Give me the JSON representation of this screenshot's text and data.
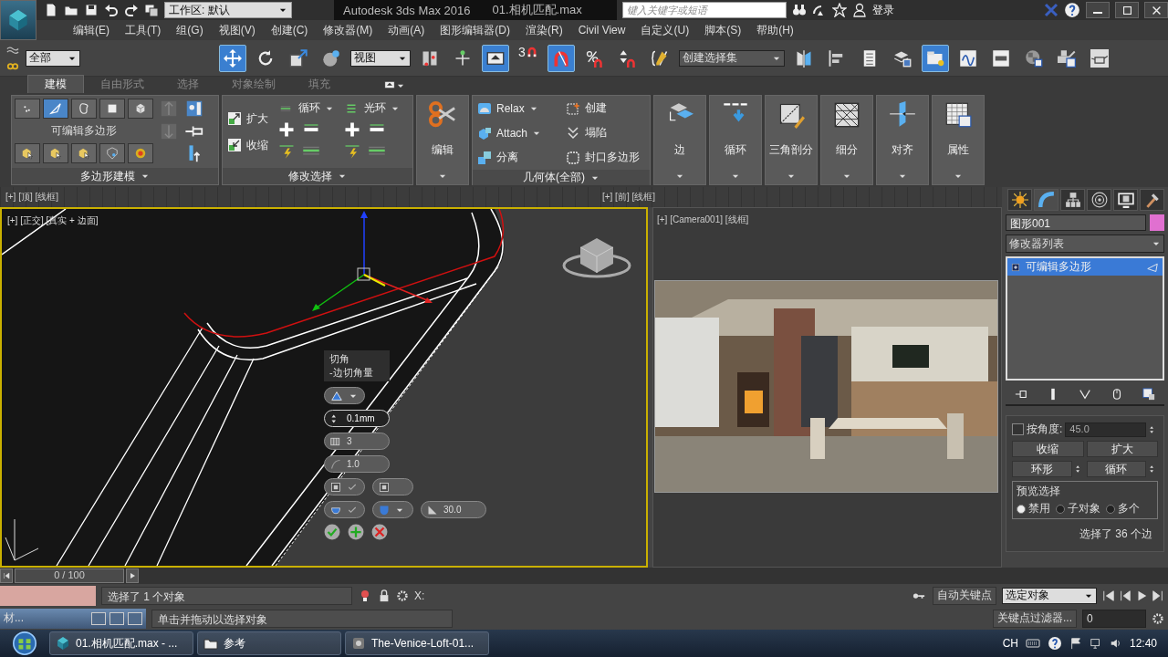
{
  "title_bar": {
    "workspace": "工作区: 默认",
    "app_title": "Autodesk 3ds Max 2016",
    "file_name": "01.相机匹配.max",
    "search": {
      "placeholder": "键入关键字或短语"
    },
    "sign_in": "登录"
  },
  "menu_bar": [
    "编辑(E)",
    "工具(T)",
    "组(G)",
    "视图(V)",
    "创建(C)",
    "修改器(M)",
    "动画(A)",
    "图形编辑器(D)",
    "渲染(R)",
    "Civil View",
    "自定义(U)",
    "脚本(S)",
    "帮助(H)"
  ],
  "main_toolbar": {
    "selection_filter": "全部",
    "reference_coordinate": "视图",
    "snap_count": "3",
    "named_selection": "创建选择集"
  },
  "ribbon": {
    "tabs": [
      {
        "label": "建模",
        "selected": true
      },
      {
        "label": "自由形式",
        "selected": false
      },
      {
        "label": "选择",
        "selected": false
      },
      {
        "label": "对象绘制",
        "selected": false
      },
      {
        "label": "填充",
        "selected": false
      }
    ],
    "polygon_modeling": {
      "title": "多边形建模",
      "object_type": "可编辑多边形",
      "subobject_levels": [
        {
          "selected": false
        },
        {
          "selected": true
        },
        {
          "selected": false
        },
        {
          "selected": false
        },
        {
          "selected": false
        }
      ]
    },
    "modify_selection": {
      "title": "修改选择",
      "grow": "扩大",
      "shrink": "收缩",
      "loop": "循环",
      "ring": "光环"
    },
    "edit": {
      "label": "编辑"
    },
    "geometry": {
      "title": "几何体(全部)",
      "items": [
        {
          "label": "Relax",
          "dropdown": true
        },
        {
          "label": "Attach",
          "dropdown": true
        },
        {
          "label": "分离",
          "dropdown": false
        },
        {
          "label": "创建",
          "dropdown": false
        },
        {
          "label": "塌陷",
          "dropdown": false
        },
        {
          "label": "封口多边形",
          "dropdown": false
        }
      ]
    },
    "big_buttons": [
      "边",
      "循环",
      "三角剖分",
      "细分",
      "对齐",
      "属性"
    ]
  },
  "viewports": {
    "top_left_label": "[+] [顶] [线框]",
    "top_right_label": "[+] [前] [线框]",
    "main_label": "[+] [正交] [真实 + 边面]",
    "camera_label": "[+] [Camera001] [线框]"
  },
  "caddy": {
    "title": "切角",
    "subtitle": "-边切角量",
    "amount": "0.1mm",
    "segments": "3",
    "tension": "1.0",
    "open_chamfer": {
      "checked": true
    },
    "invert_open": {
      "checked": false
    },
    "smooth": {
      "checked": true
    },
    "angle": "30.0"
  },
  "command_panel": {
    "object_name": "图形001",
    "modifier_list": "修改器列表",
    "stack": [
      {
        "label": "可编辑多边形",
        "selected": true
      }
    ],
    "by_angle": {
      "label": "按角度:",
      "checked": false,
      "value": "45.0"
    },
    "buttons": [
      "收缩",
      "扩大"
    ],
    "spinner_buttons": [
      "环形",
      "循环"
    ],
    "preview": {
      "title": "预览选择",
      "options": [
        {
          "label": "禁用",
          "selected": true
        },
        {
          "label": "子对象",
          "selected": false
        },
        {
          "label": "多个",
          "selected": false
        }
      ]
    },
    "selection_info": "选择了 36 个边"
  },
  "time_slider": {
    "position": "0 / 100"
  },
  "status": {
    "selection": "选择了 1 个对象",
    "prompt": "单击并拖动以选择对象",
    "coord_label": "X:",
    "auto_key": "自动关键点",
    "key_set": "选定对象",
    "key_filters": "关键点过滤器...",
    "frame": "0"
  },
  "mini_window": {
    "title": "材..."
  },
  "taskbar": {
    "tasks": [
      {
        "label": "01.相机匹配.max - ...",
        "kind": "max"
      },
      {
        "label": "参考",
        "kind": "folder"
      },
      {
        "label": "The-Venice-Loft-01...",
        "kind": "app"
      }
    ],
    "language": "CH",
    "clock": "12:40"
  }
}
